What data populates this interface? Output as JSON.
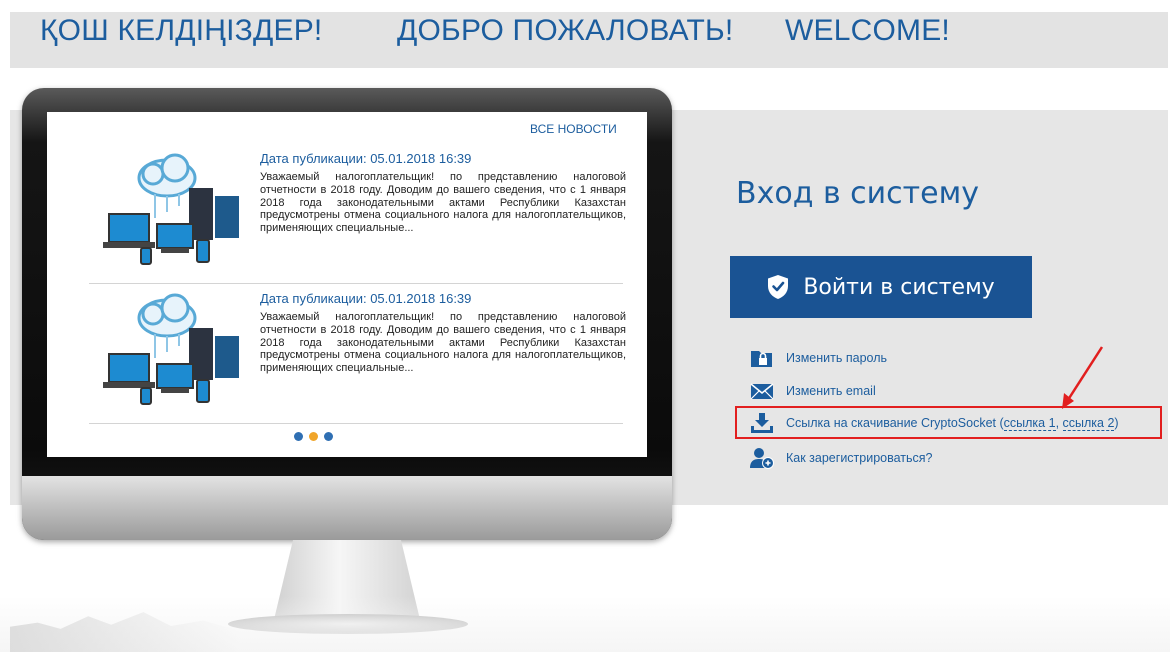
{
  "header": {
    "welcome_kz": "ҚОШ КЕЛДІҢІЗДЕР!",
    "welcome_ru": "ДОБРО ПОЖАЛОВАТЬ!",
    "welcome_en": "WELCOME!"
  },
  "news": {
    "all_news_label": "ВСЕ НОВОСТИ",
    "items": [
      {
        "date": "Дата публикации: 05.01.2018 16:39",
        "text": "Уважаемый налогоплательщик! по представлению налоговой отчетности в 2018 году. Доводим до вашего сведения, что с 1 января 2018 года законодательными актами Республики Казахстан предусмотрены отмена социального налога для налогоплательщиков, применяющих специальные..."
      },
      {
        "date": "Дата публикации: 05.01.2018 16:39",
        "text": "Уважаемый налогоплательщик! по представлению налоговой отчетности в 2018 году. Доводим до вашего сведения, что с 1 января 2018 года законодательными актами Республики Казахстан предусмотрены отмена социального налога для налогоплательщиков, применяющих специальные..."
      }
    ],
    "carousel_active_index": 1
  },
  "login": {
    "title": "Вход в систему",
    "button_label": "Войти в систему",
    "links": {
      "change_password": "Изменить пароль",
      "change_email": "Изменить email",
      "download_prefix": "Ссылка на скачивание CryptoSocket (",
      "link1": "ссылка 1",
      "separator": ", ",
      "link2": "ссылка 2",
      "download_suffix": ")",
      "how_to_register": "Как зарегистрироваться?"
    }
  },
  "colors": {
    "brand_blue": "#1c5d9e",
    "button_blue": "#1a5393",
    "highlight_red": "#e21f1f",
    "carousel_active": "#f0a52a"
  },
  "icons": {
    "change_password": "folder-lock-icon",
    "change_email": "envelope-icon",
    "download": "download-icon",
    "register": "user-add-icon",
    "login_button": "shield-check-icon"
  }
}
